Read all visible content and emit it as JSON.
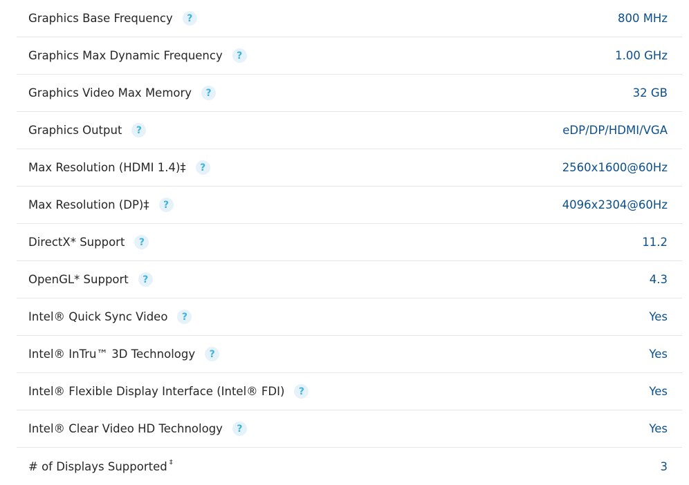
{
  "help_glyph": "?",
  "specs": [
    {
      "label": "Graphics Base Frequency",
      "value": "800 MHz",
      "has_help": true
    },
    {
      "label": "Graphics Max Dynamic Frequency",
      "value": "1.00 GHz",
      "has_help": true
    },
    {
      "label": "Graphics Video Max Memory",
      "value": "32 GB",
      "has_help": true
    },
    {
      "label": "Graphics Output",
      "value": "eDP/DP/HDMI/VGA",
      "has_help": true
    },
    {
      "label": "Max Resolution (HDMI 1.4)‡",
      "value": "2560x1600@60Hz",
      "has_help": true
    },
    {
      "label": "Max Resolution (DP)‡",
      "value": "4096x2304@60Hz",
      "has_help": true
    },
    {
      "label": "DirectX* Support",
      "value": "11.2",
      "has_help": true
    },
    {
      "label": "OpenGL* Support",
      "value": "4.3",
      "has_help": true
    },
    {
      "label": "Intel® Quick Sync Video",
      "value": "Yes",
      "has_help": true
    },
    {
      "label": "Intel® InTru™ 3D Technology",
      "value": "Yes",
      "has_help": true
    },
    {
      "label": "Intel® Flexible Display Interface (Intel® FDI)",
      "value": "Yes",
      "has_help": true
    },
    {
      "label": "Intel® Clear Video HD Technology",
      "value": "Yes",
      "has_help": true
    },
    {
      "label": "# of Displays Supported",
      "label_sup": "‡",
      "value": "3",
      "has_help": false
    }
  ],
  "colors": {
    "label_text": "#262626",
    "value_text": "#0b4f8c",
    "divider": "#e5e5e5",
    "help_icon_bg": "#e6f2fa",
    "help_icon_fg": "#3fb3e0"
  }
}
